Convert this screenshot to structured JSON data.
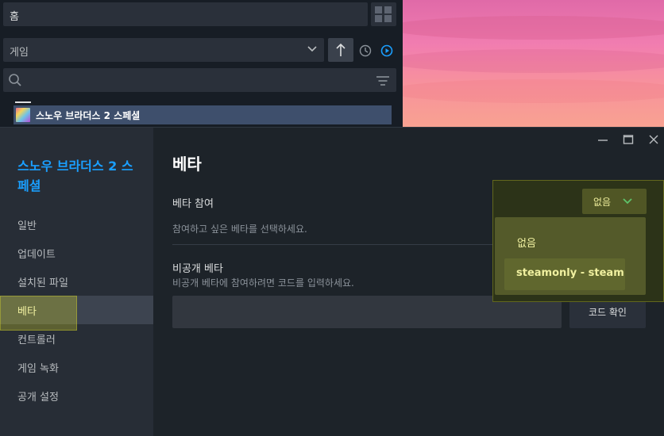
{
  "library": {
    "home_label": "홈",
    "filter_label": "게임",
    "game_title": "스노우 브라더스 2 스페셜"
  },
  "icons": {
    "grid": "grid-view-icon",
    "chevron": "chevron-down-icon",
    "sort": "sort-up-arrow-icon",
    "clock": "clock-icon",
    "play": "play-circle-icon",
    "search": "search-icon",
    "filter_list": "filter-list-icon"
  },
  "dialog": {
    "game_name": "스노우 브라더스 2 스페셜",
    "nav": [
      "일반",
      "업데이트",
      "설치된 파일",
      "베타",
      "컨트롤러",
      "게임 녹화",
      "공개 설정"
    ],
    "active_nav_index": 3,
    "content": {
      "title": "베타",
      "beta_participate_label": "베타 참여",
      "beta_participate_desc": "참여하고 싶은 베타를 선택하세요.",
      "private_beta_label": "비공개 베타",
      "private_beta_desc": "비공개 베타에 참여하려면 코드를 입력하세요.",
      "code_input_value": "",
      "code_confirm_label": "코드 확인"
    },
    "dropdown": {
      "selected": "없음",
      "options": [
        "없음",
        "steamonly - steam"
      ]
    }
  },
  "colors": {
    "accent_blue": "#1a9fff",
    "highlight_yellow": "#e6e628",
    "selected_nav_bg": "#3d4450"
  }
}
